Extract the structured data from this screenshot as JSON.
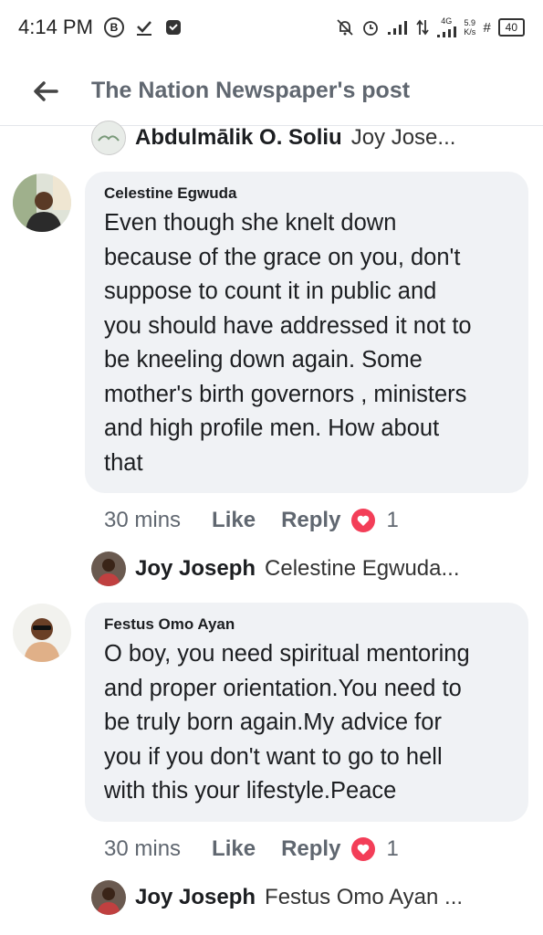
{
  "status_bar": {
    "time": "4:14 PM",
    "icons": [
      "b-circle-icon",
      "download-check-icon",
      "chat-app-icon",
      "mute-icon",
      "alarm-icon",
      "signal-icon",
      "data-arrows-icon",
      "4g-signal-icon",
      "hashtag-icon",
      "battery-icon"
    ],
    "network": "4G",
    "speed_value": "5.9",
    "speed_unit": "K/s",
    "battery": "40"
  },
  "app_bar": {
    "title": "The Nation Newspaper's post"
  },
  "top_reply": {
    "name": "Abdulmālik O. Soliu",
    "snippet": "Joy Jose..."
  },
  "comments": [
    {
      "author": "Celestine Egwuda",
      "lines": [
        "Even though she knelt down",
        "because of the grace on you,  don't",
        "suppose to count it in public and",
        "you should have addressed it not to",
        "be kneeling down again. Some",
        "mother's birth governors , ministers",
        "and high profile men. How about",
        "that"
      ],
      "time": "30 mins",
      "like": "Like",
      "reply": "Reply",
      "reactions": "1",
      "reply_preview": {
        "name": "Joy Joseph",
        "snippet": "Celestine Egwuda..."
      }
    },
    {
      "author": "Festus Omo Ayan",
      "lines": [
        "O boy, you need spiritual mentoring",
        "and proper orientation.You need to",
        "be truly born again.My advice for",
        "you if you don't want to go to hell",
        "with this your lifestyle.Peace"
      ],
      "time": "30 mins",
      "like": "Like",
      "reply": "Reply",
      "reactions": "1",
      "reply_preview": {
        "name": "Joy Joseph",
        "snippet": "Festus Omo Ayan ..."
      }
    }
  ],
  "colors": {
    "bubble": "#f0f2f5",
    "meta_text": "#606770",
    "love_reaction": "#f33e58"
  }
}
